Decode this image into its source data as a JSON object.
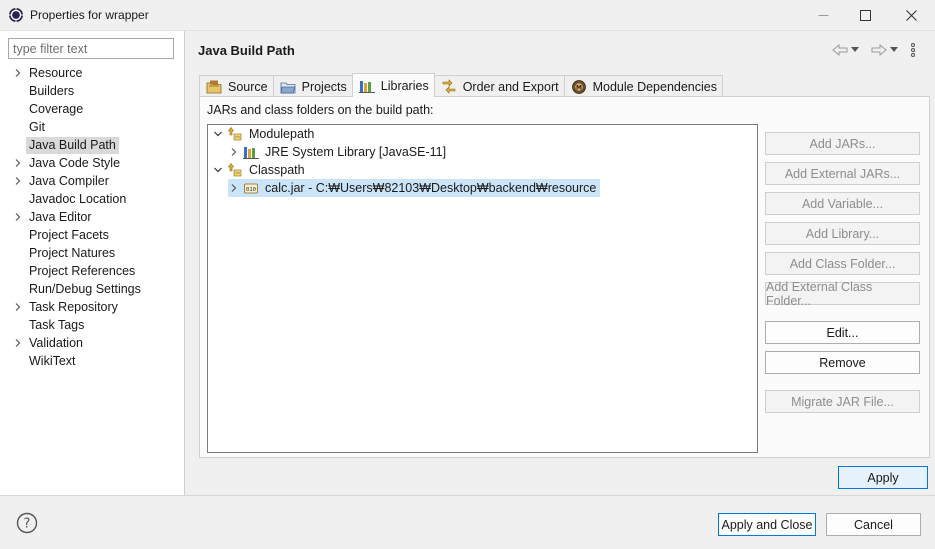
{
  "window": {
    "title": "Properties for wrapper",
    "minimize_glyph": "—",
    "maximize_glyph": "☐",
    "close_glyph": "✕"
  },
  "filter": {
    "placeholder": "type filter text",
    "value": ""
  },
  "nav": {
    "items": [
      {
        "label": "Resource",
        "expandable": true
      },
      {
        "label": "Builders",
        "expandable": false
      },
      {
        "label": "Coverage",
        "expandable": false
      },
      {
        "label": "Git",
        "expandable": false
      },
      {
        "label": "Java Build Path",
        "expandable": false,
        "selected": true
      },
      {
        "label": "Java Code Style",
        "expandable": true
      },
      {
        "label": "Java Compiler",
        "expandable": true
      },
      {
        "label": "Javadoc Location",
        "expandable": false
      },
      {
        "label": "Java Editor",
        "expandable": true
      },
      {
        "label": "Project Facets",
        "expandable": false
      },
      {
        "label": "Project Natures",
        "expandable": false
      },
      {
        "label": "Project References",
        "expandable": false
      },
      {
        "label": "Run/Debug Settings",
        "expandable": false
      },
      {
        "label": "Task Repository",
        "expandable": true
      },
      {
        "label": "Task Tags",
        "expandable": false
      },
      {
        "label": "Validation",
        "expandable": true
      },
      {
        "label": "WikiText",
        "expandable": false
      }
    ]
  },
  "page": {
    "title": "Java Build Path"
  },
  "tabs": [
    {
      "label": "Source",
      "icon": "source-folder-icon"
    },
    {
      "label": "Projects",
      "icon": "projects-folder-icon"
    },
    {
      "label": "Libraries",
      "icon": "libraries-icon",
      "active": true
    },
    {
      "label": "Order and Export",
      "icon": "order-export-icon"
    },
    {
      "label": "Module Dependencies",
      "icon": "module-dependencies-icon"
    }
  ],
  "libraries": {
    "heading": "JARs and class folders on the build path:",
    "tree": {
      "modulepath": "Modulepath",
      "jre": "JRE System Library [JavaSE-11]",
      "classpath": "Classpath",
      "jar": "calc.jar - C:₩Users₩82103₩Desktop₩backend₩resource"
    },
    "buttons": {
      "add_jars": "Add JARs...",
      "add_external_jars": "Add External JARs...",
      "add_variable": "Add Variable...",
      "add_library": "Add Library...",
      "add_class_folder": "Add Class Folder...",
      "add_external_class_folder": "Add External Class Folder...",
      "edit": "Edit...",
      "remove": "Remove",
      "migrate_jar": "Migrate JAR File..."
    }
  },
  "apply_label": "Apply",
  "footer": {
    "help_glyph": "?",
    "apply_close_label": "Apply and Close",
    "cancel_label": "Cancel"
  },
  "colors": {
    "selection_blue": "#cce4f7",
    "focus_border": "#0078d7",
    "nav_selected": "#d9d9d9"
  }
}
